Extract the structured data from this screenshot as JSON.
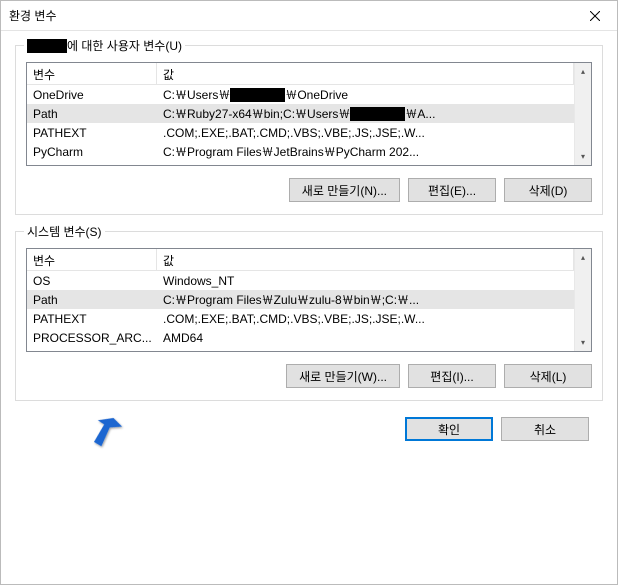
{
  "dialog": {
    "title": "환경 변수",
    "close_icon": "close"
  },
  "user_vars": {
    "label_suffix": "에 대한 사용자 변수(U)",
    "header_name": "변수",
    "header_value": "값",
    "rows": [
      {
        "name": "OneDrive",
        "value_prefix": "C:￦Users￦",
        "value_suffix": "￦OneDrive",
        "redacted_mid": true
      },
      {
        "name": "Path",
        "value_prefix": "C:￦Ruby27-x64￦bin;C:￦Users￦",
        "value_suffix": "￦A...",
        "redacted_mid": true,
        "selected": true
      },
      {
        "name": "PATHEXT",
        "value": ".COM;.EXE;.BAT;.CMD;.VBS;.VBE;.JS;.JSE;.W..."
      },
      {
        "name": "PyCharm",
        "value": "C:￦Program Files￦JetBrains￦PyCharm 202..."
      }
    ],
    "buttons": {
      "new": "새로 만들기(N)...",
      "edit": "편집(E)...",
      "delete": "삭제(D)"
    }
  },
  "system_vars": {
    "label": "시스템 변수(S)",
    "header_name": "변수",
    "header_value": "값",
    "rows": [
      {
        "name": "OS",
        "value": "Windows_NT"
      },
      {
        "name": "Path",
        "value": "C:￦Program Files￦Zulu￦zulu-8￦bin￦;C:￦...",
        "selected": true
      },
      {
        "name": "PATHEXT",
        "value": ".COM;.EXE;.BAT;.CMD;.VBS;.VBE;.JS;.JSE;.W..."
      },
      {
        "name": "PROCESSOR_ARC...",
        "value": "AMD64"
      }
    ],
    "buttons": {
      "new": "새로 만들기(W)...",
      "edit": "편집(I)...",
      "delete": "삭제(L)"
    }
  },
  "dialog_buttons": {
    "ok": "확인",
    "cancel": "취소"
  }
}
